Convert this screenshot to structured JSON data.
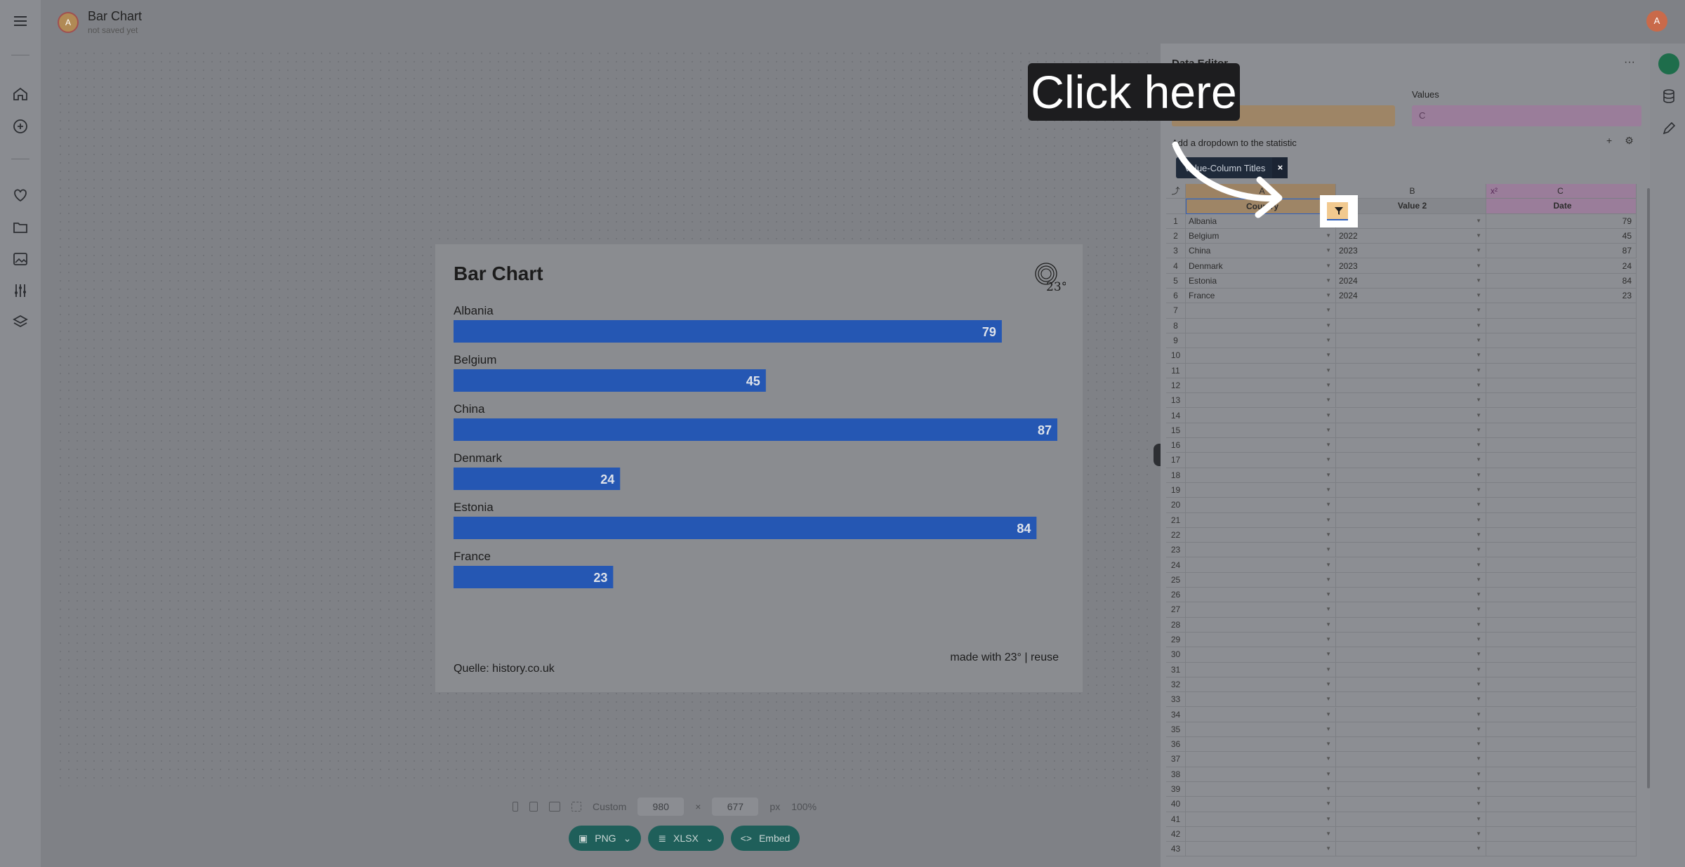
{
  "app": {
    "title": "Bar Chart",
    "subtitle": "not saved yet",
    "avatar_left": "A",
    "avatar_right": "A"
  },
  "rail": {
    "icons": [
      "menu-icon",
      "home-icon",
      "add-icon",
      "heart-icon",
      "folder-icon",
      "image-icon",
      "sliders-icon",
      "layers-icon"
    ]
  },
  "chart": {
    "title": "Bar Chart",
    "logo_text": "23°",
    "footer": "made with 23° | reuse",
    "source": "Quelle: history.co.uk",
    "bar_color": "#2557b3"
  },
  "chart_data": {
    "type": "bar",
    "orientation": "horizontal",
    "title": "Bar Chart",
    "categories": [
      "Albania",
      "Belgium",
      "China",
      "Denmark",
      "Estonia",
      "France"
    ],
    "values": [
      79,
      45,
      87,
      24,
      84,
      23
    ],
    "xlabel": "",
    "ylabel": "",
    "grid": false
  },
  "size_bar": {
    "preset": "Custom",
    "width": "980",
    "times": "×",
    "height": "677",
    "unit": "px",
    "zoom": "100%"
  },
  "export": {
    "png": "PNG",
    "xlsx": "XLSX",
    "embed": "Embed"
  },
  "editor": {
    "title": "Data Editor",
    "more": "···",
    "values_label": "Values",
    "values_value": "C",
    "dropdown_label": "Add a dropdown to the statistic",
    "chip_label": "Value-Column Titles",
    "chip_close": "×",
    "add": "+",
    "columns": {
      "a_letter": "A",
      "b_letter": "B",
      "c_letter": "C",
      "c_badge": "x²",
      "a_name": "Country",
      "b_name": "Value 2",
      "c_name": "Date"
    },
    "rows": [
      {
        "n": "1",
        "a": "Albania",
        "b": "2022",
        "c": "79"
      },
      {
        "n": "2",
        "a": "Belgium",
        "b": "2022",
        "c": "45"
      },
      {
        "n": "3",
        "a": "China",
        "b": "2023",
        "c": "87"
      },
      {
        "n": "4",
        "a": "Denmark",
        "b": "2023",
        "c": "24"
      },
      {
        "n": "5",
        "a": "Estonia",
        "b": "2024",
        "c": "84"
      },
      {
        "n": "6",
        "a": "France",
        "b": "2024",
        "c": "23"
      }
    ],
    "empty_row_count": 37
  },
  "overlay": {
    "callout": "Click here"
  },
  "colors": {
    "accent": "#2557b3",
    "export_button": "#1f5f5a",
    "label_column": "#f3c98f",
    "value_column": "#e7b5e7"
  }
}
